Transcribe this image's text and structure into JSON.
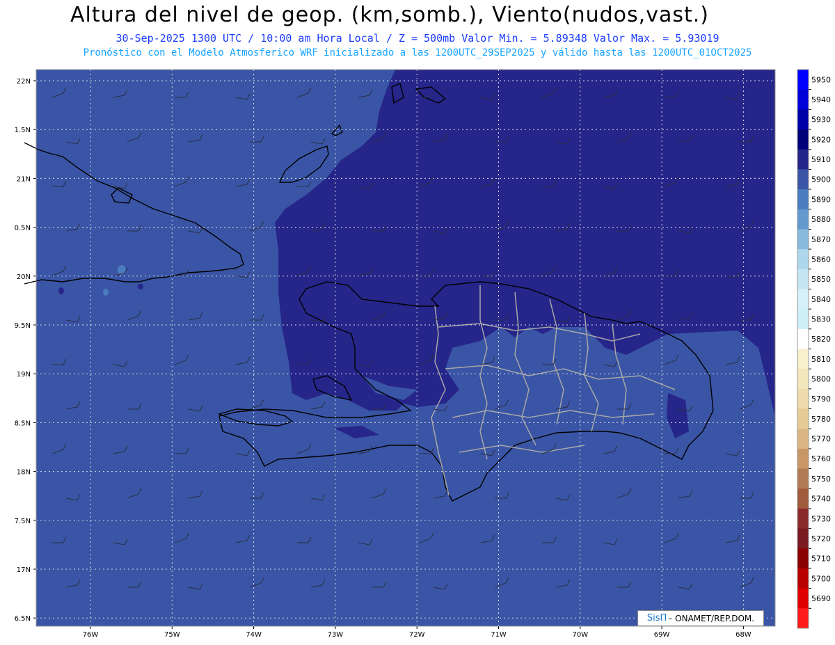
{
  "title": "Altura del nivel de geop. (km,somb.), Viento(nudos,vast.)",
  "subtitle1": "30-Sep-2025  1300 UTC / 10:00 am Hora Local / Z = 500mb    Valor Min. = 5.89348  Valor Max. = 5.93019",
  "subtitle2": "Pronóstico con el Modelo Atmosferico WRF inicializado a las 1200UTC_29SEP2025 y válido hasta las  1200UTC_01OCT2025",
  "lat_labels": [
    "22N",
    "1.5N",
    "21N",
    "0.5N",
    "20N",
    "9.5N",
    "19N",
    "8.5N",
    "18N",
    "7.5N",
    "17N",
    "6.5N"
  ],
  "lon_labels": [
    "76W",
    "75W",
    "74W",
    "73W",
    "72W",
    "71W",
    "70W",
    "69W",
    "68W"
  ],
  "colorbar": {
    "levels": [
      5950,
      5940,
      5930,
      5920,
      5910,
      5900,
      5890,
      5880,
      5870,
      5860,
      5850,
      5840,
      5830,
      5820,
      5810,
      5800,
      5790,
      5780,
      5770,
      5760,
      5750,
      5740,
      5730,
      5720,
      5710,
      5700,
      5690
    ],
    "colors": [
      "#0000ff",
      "#0000d8",
      "#0000a8",
      "#000078",
      "#26258a",
      "#3a55a5",
      "#4a7cbf",
      "#6399cc",
      "#88b9de",
      "#afd7ec",
      "#c4e6f3",
      "#d6f0f8",
      "#cdeff6",
      "#ffffff",
      "#f8f0cc",
      "#f2e6bb",
      "#eedaaa",
      "#e6cb96",
      "#d9b681",
      "#c99666",
      "#b07b55",
      "#a05a3c",
      "#8a2a2a",
      "#7a1a20",
      "#8b0000",
      "#b80000",
      "#e00000",
      "#ff1a1a"
    ]
  },
  "field_colors": {
    "5900": "#3a55a5",
    "5910": "#26258a",
    "5890": "#4a7cbf"
  },
  "credit": {
    "brand": "SisΠ",
    "text": "– ONAMET/REP.DOM."
  }
}
